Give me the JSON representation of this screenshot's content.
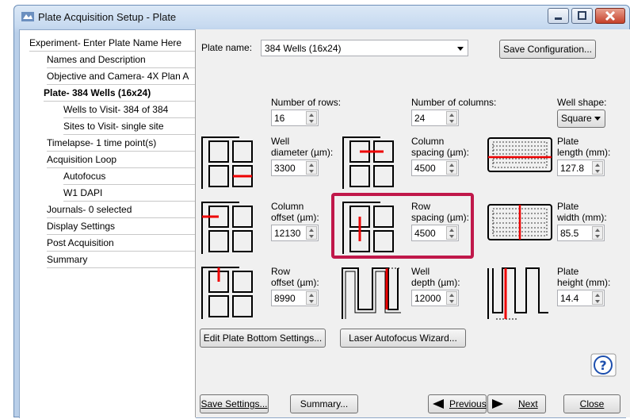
{
  "window": {
    "title": "Plate Acquisition Setup - Plate"
  },
  "tree": [
    {
      "label": "Experiment- Enter Plate Name Here"
    },
    {
      "label": "Names and Description"
    },
    {
      "label": "Objective and Camera- 4X Plan A"
    },
    {
      "label": "Plate- 384 Wells (16x24)"
    },
    {
      "label": "Wells to Visit- 384 of 384"
    },
    {
      "label": "Sites to Visit- single site"
    },
    {
      "label": "Timelapse- 1 time point(s)"
    },
    {
      "label": "Acquisition Loop"
    },
    {
      "label": "Autofocus"
    },
    {
      "label": "W1 DAPI"
    },
    {
      "label": "Journals- 0 selected"
    },
    {
      "label": "Display Settings"
    },
    {
      "label": "Post Acquisition"
    },
    {
      "label": "Summary"
    }
  ],
  "plate": {
    "name_label": "Plate name:",
    "name_value": "384 Wells (16x24)",
    "save_config": "Save Configuration...",
    "rows_label": "Number of rows:",
    "rows_value": "16",
    "cols_label": "Number of columns:",
    "cols_value": "24",
    "shape_label": "Well shape:",
    "shape_value": "Square",
    "well_diam_label1": "Well",
    "well_diam_label2": "diameter (µm):",
    "well_diam_value": "3300",
    "col_spacing_label1": "Column",
    "col_spacing_label2": "spacing (µm):",
    "col_spacing_value": "4500",
    "plate_length_label1": "Plate",
    "plate_length_label2": "length (mm):",
    "plate_length_value": "127.8",
    "col_offset_label1": "Column",
    "col_offset_label2": "offset (µm):",
    "col_offset_value": "12130",
    "row_spacing_label1": "Row",
    "row_spacing_label2": "spacing (µm):",
    "row_spacing_value": "4500",
    "plate_width_label1": "Plate",
    "plate_width_label2": "width (mm):",
    "plate_width_value": "85.5",
    "row_offset_label1": "Row",
    "row_offset_label2": "offset (µm):",
    "row_offset_value": "8990",
    "well_depth_label1": "Well",
    "well_depth_label2": "depth (µm):",
    "well_depth_value": "12000",
    "plate_height_label1": "Plate",
    "plate_height_label2": "height (mm):",
    "plate_height_value": "14.4",
    "edit_bottom": "Edit Plate Bottom Settings...",
    "laser_af": "Laser Autofocus Wizard..."
  },
  "footer": {
    "save_settings": "Save Settings...",
    "summary": "Summary...",
    "previous": "Previous",
    "next": "Next",
    "close": "Close"
  }
}
